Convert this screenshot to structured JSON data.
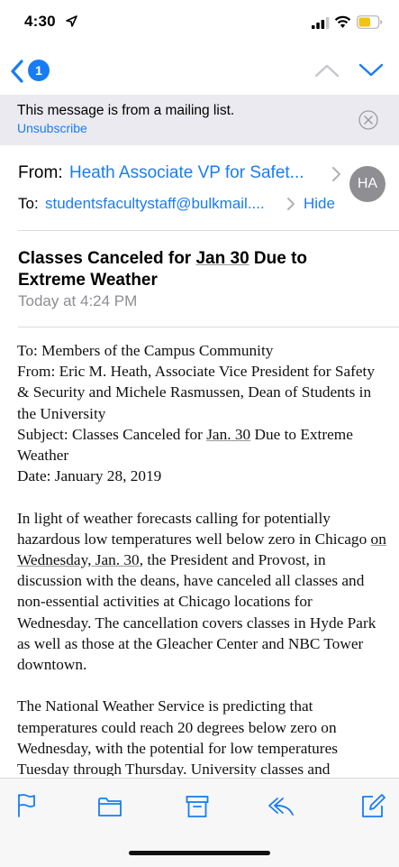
{
  "status_bar": {
    "time": "4:30"
  },
  "nav": {
    "unread_count": "1"
  },
  "banner": {
    "message": "This message is from a mailing list.",
    "unsubscribe": "Unsubscribe"
  },
  "header": {
    "from_label": "From:",
    "from_name": "Heath Associate VP for Safet...",
    "to_label": "To:",
    "to_address": "studentsfacultystaff@bulkmail....",
    "hide": "Hide",
    "avatar_initials": "HA"
  },
  "subject": {
    "part1": "Classes Canceled for ",
    "part2": "Jan 30",
    "part3": " Due to Extreme Weather"
  },
  "date": "Today at 4:24 PM",
  "body": {
    "to_line": "To: Members of the Campus Community",
    "from_line": "From: Eric M. Heath, Associate Vice President for Safety & Security and Michele Rasmussen, Dean of Students in the University",
    "subject_a": "Subject: Classes Canceled for ",
    "subject_b": "Jan. 30",
    "subject_c": " Due to Extreme Weather",
    "date_line": "Date: January 28, 2019",
    "para1_a": "In light of weather forecasts calling for potentially hazardous low temperatures well below zero in Chicago ",
    "para1_b": "on Wednesday, Jan. 30",
    "para1_c": ", the President and Provost, in discussion with the deans, have canceled all classes and non-essential activities at Chicago locations for Wednesday. The cancellation covers classes in Hyde Park as well as those at the Gleacher Center and NBC Tower downtown.",
    "para2": "The National Weather Service is predicting that temperatures could reach 20 degrees below zero on Wednesday, with the potential for low temperatures Tuesday through Thursday. University classes and"
  },
  "toolbar": {
    "icons": [
      "flag-icon",
      "folder-icon",
      "archive-icon",
      "reply-icon",
      "compose-icon"
    ]
  },
  "colors": {
    "accent": "#1a7cf4",
    "banner_bg": "#eaeaf0",
    "secondary_text": "#8e8e93"
  }
}
